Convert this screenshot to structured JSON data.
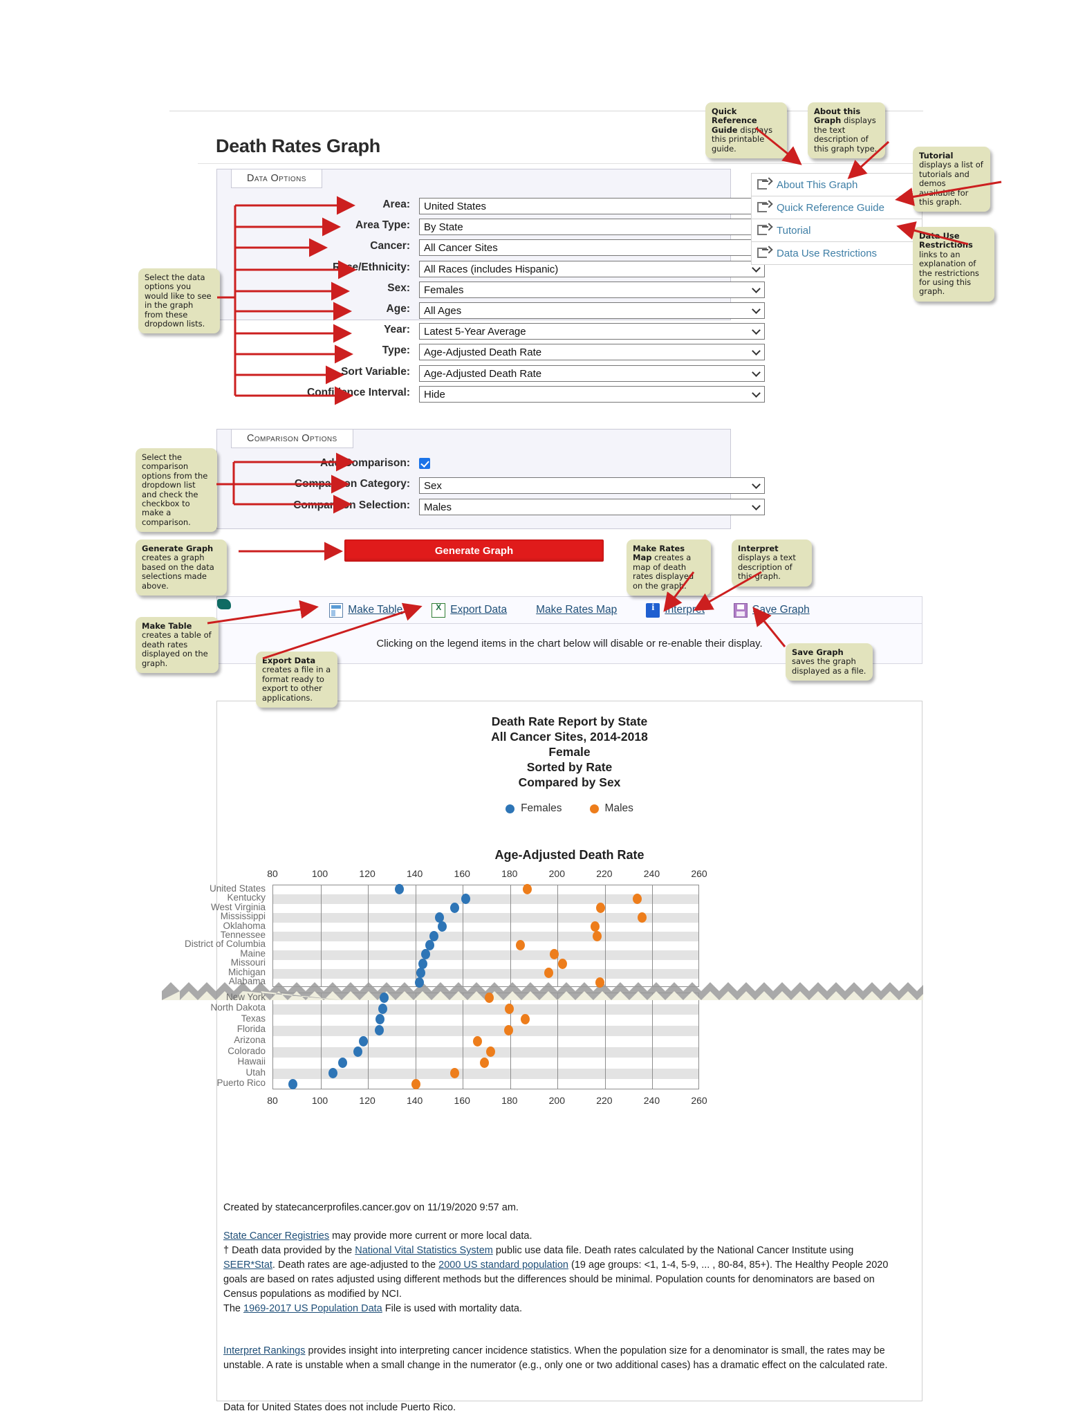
{
  "page": {
    "title": "Death Rates Graph"
  },
  "data_options": {
    "legend": "Data Options",
    "fields": [
      {
        "label": "Area:",
        "value": "United States"
      },
      {
        "label": "Area Type:",
        "value": "By State"
      },
      {
        "label": "Cancer:",
        "value": "All Cancer Sites"
      },
      {
        "label": "Race/Ethnicity:",
        "value": "All Races (includes Hispanic)"
      },
      {
        "label": "Sex:",
        "value": "Females"
      },
      {
        "label": "Age:",
        "value": "All Ages"
      },
      {
        "label": "Year:",
        "value": "Latest 5-Year Average"
      },
      {
        "label": "Type:",
        "value": "Age-Adjusted Death Rate"
      },
      {
        "label": "Sort Variable:",
        "value": "Age-Adjusted Death Rate"
      },
      {
        "label": "Confidence Interval:",
        "value": "Hide"
      }
    ]
  },
  "comparison_options": {
    "legend": "Comparison Options",
    "add_comparison_label": "Add Comparison:",
    "add_comparison_checked": true,
    "fields": [
      {
        "label": "Comparison Category:",
        "value": "Sex"
      },
      {
        "label": "Comparison Selection:",
        "value": "Males"
      }
    ]
  },
  "right_links": [
    {
      "label": "About This Graph",
      "icon": "external-link-icon"
    },
    {
      "label": "Quick Reference Guide",
      "icon": "external-link-icon"
    },
    {
      "label": "Tutorial",
      "icon": "external-link-icon"
    },
    {
      "label": "Data Use Restrictions",
      "icon": "external-link-icon"
    }
  ],
  "generate_button": {
    "label": "Generate Graph"
  },
  "action_bar": {
    "items": [
      {
        "label": "Make Table",
        "icon": "table-icon"
      },
      {
        "label": "Export Data",
        "icon": "excel-file-icon"
      },
      {
        "label": "Make Rates Map",
        "icon": "us-map-icon"
      },
      {
        "label": "Interpret",
        "icon": "info-icon"
      },
      {
        "label": "Save Graph",
        "icon": "floppy-disk-icon"
      }
    ],
    "note": "Clicking on the legend items in the chart below will disable or re-enable their display."
  },
  "callouts": [
    {
      "id": "quick-reference-guide-callout",
      "bold": "Quick Reference Guide",
      "text": " displays this printable guide."
    },
    {
      "id": "about-this-graph-callout",
      "bold": "About this Graph",
      "text": " displays the text description of this graph type."
    },
    {
      "id": "tutorial-callout",
      "bold": "Tutorial",
      "text": " displays a list of tutorials and demos available for this graph."
    },
    {
      "id": "data-use-restrictions-callout",
      "bold": "Data Use Restrictions",
      "text": " links to an explanation of the restrictions for using this graph."
    },
    {
      "id": "data-options-callout",
      "bold": "",
      "text": "Select the data options you would like to see in the graph from these dropdown lists."
    },
    {
      "id": "comparison-options-callout",
      "bold": "",
      "text": "Select the comparison options from the dropdown list and check the checkbox to make a comparison."
    },
    {
      "id": "generate-graph-callout",
      "bold": "Generate Graph",
      "text": " creates a graph based on the data selections made above."
    },
    {
      "id": "make-rates-map-callout",
      "bold": "Make Rates Map",
      "text": " creates a map of death rates displayed on the graph."
    },
    {
      "id": "interpret-callout",
      "bold": "Interpret",
      "text": " displays a text description of this graph."
    },
    {
      "id": "make-table-callout",
      "bold": "Make Table",
      "text": " creates a table of death rates displayed on the graph."
    },
    {
      "id": "export-data-callout",
      "bold": "Export Data",
      "text": " creates a file in a format ready to export to other applications."
    },
    {
      "id": "save-graph-callout",
      "bold": "Save Graph",
      "text": " saves the graph displayed as a file."
    }
  ],
  "chart_data": {
    "type": "scatter",
    "title": "Death Rate Report by State",
    "title_lines": [
      "Death Rate Report by State",
      "All Cancer Sites, 2014-2018",
      "Female",
      "Sorted by Rate",
      "Compared by Sex"
    ],
    "xlabel": "Age-Adjusted Death Rate",
    "ylabel": "",
    "xlim": [
      80,
      260
    ],
    "xticks": [
      80,
      100,
      120,
      140,
      160,
      180,
      200,
      220,
      240,
      260
    ],
    "grid": true,
    "legend_position": "top",
    "axis_break": true,
    "colors": {
      "females": "#2e75b6",
      "males": "#ed7d1b"
    },
    "series": [
      {
        "name": "Females",
        "color": "#2e75b6"
      },
      {
        "name": "Males",
        "color": "#ed7d1b"
      }
    ],
    "categories_top": [
      "United States",
      "Kentucky",
      "West Virginia",
      "Mississippi",
      "Oklahoma",
      "Tennessee",
      "District of Columbia",
      "Maine",
      "Missouri",
      "Michigan",
      "Alabama"
    ],
    "categories_bottom": [
      "New York",
      "North Dakota",
      "Texas",
      "Florida",
      "Arizona",
      "Colorado",
      "Hawaii",
      "Utah",
      "Puerto Rico"
    ],
    "values_top": {
      "Females": [
        133.5,
        161.5,
        157.0,
        150.5,
        151.5,
        148.0,
        146.5,
        144.5,
        143.5,
        142.5,
        142.0
      ],
      "Males": [
        187.5,
        234.0,
        218.5,
        236.0,
        216.0,
        217.0,
        184.5,
        199.0,
        202.5,
        196.5,
        218.0
      ]
    },
    "values_bottom": {
      "Females": [
        127.0,
        126.5,
        125.5,
        125.0,
        118.5,
        116.0,
        109.5,
        105.5,
        88.5
      ],
      "Males": [
        171.5,
        180.0,
        186.5,
        179.5,
        166.5,
        172.0,
        169.5,
        157.0,
        140.5
      ]
    }
  },
  "footnotes": {
    "created": "Created by statecancerprofiles.cancer.gov on 11/19/2020 9:57 am.",
    "registries_link": "State Cancer Registries",
    "registries_rest": " may provide more current or more local data.",
    "dagger_pre": "† Death data provided by the ",
    "nvss_link": "National Vital Statistics System",
    "dagger_mid1": " public use data file. Death rates calculated by the National Cancer Institute using ",
    "seer_link": "SEER*Stat",
    "dagger_mid2": ". Death rates are age-adjusted to the ",
    "std_pop_link": "2000 US standard population",
    "dagger_mid3": " (19 age groups: <1, 1-4, 5-9, ... , 80-84, 85+). The Healthy People 2020 goals are based on rates adjusted using different methods but the differences should be minimal. Population counts for denominators are based on Census populations as modified by NCI.",
    "pop_pre": "The ",
    "pop_link": "1969-2017 US Population Data",
    "pop_rest": " File is used with mortality data.",
    "interpret_link": "Interpret Rankings",
    "interpret_rest": " provides insight into interpreting cancer incidence statistics. When the population size for a denominator is small, the rates may be unstable. A rate is unstable when a small change in the numerator (e.g., only one or two additional cases) has a dramatic effect on the calculated rate.",
    "pr_note": "Data for United States does not include Puerto Rico."
  }
}
